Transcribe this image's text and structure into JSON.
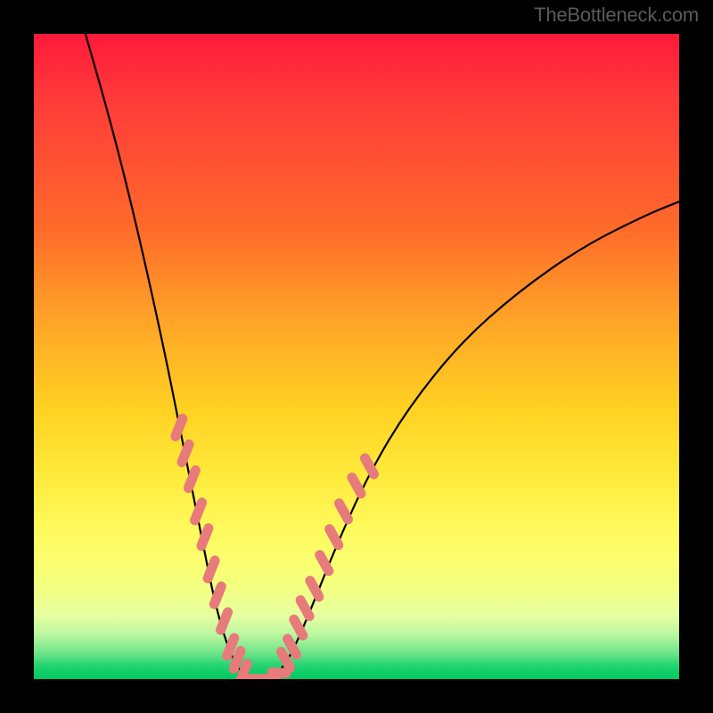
{
  "watermark": {
    "text": "TheBottleneck.com"
  },
  "chart_data": {
    "type": "line",
    "title": "",
    "xlabel": "",
    "ylabel": "",
    "xlim": [
      0,
      100
    ],
    "ylim": [
      0,
      100
    ],
    "curve": {
      "name": "bottleneck-curve",
      "description": "V-shaped bottleneck curve; minimum (green zone) around x≈33, rising steeply on both sides into red zone",
      "points": [
        {
          "x": 8,
          "y": 100
        },
        {
          "x": 12,
          "y": 86
        },
        {
          "x": 16,
          "y": 70
        },
        {
          "x": 20,
          "y": 52
        },
        {
          "x": 23,
          "y": 37
        },
        {
          "x": 26,
          "y": 22
        },
        {
          "x": 28,
          "y": 12
        },
        {
          "x": 30,
          "y": 5
        },
        {
          "x": 32,
          "y": 1
        },
        {
          "x": 34,
          "y": 0
        },
        {
          "x": 36,
          "y": 0
        },
        {
          "x": 38,
          "y": 1
        },
        {
          "x": 40,
          "y": 4
        },
        {
          "x": 43,
          "y": 11
        },
        {
          "x": 47,
          "y": 21
        },
        {
          "x": 52,
          "y": 32
        },
        {
          "x": 58,
          "y": 42
        },
        {
          "x": 66,
          "y": 52
        },
        {
          "x": 75,
          "y": 60
        },
        {
          "x": 85,
          "y": 67
        },
        {
          "x": 95,
          "y": 72
        },
        {
          "x": 100,
          "y": 74
        }
      ]
    },
    "markers": {
      "name": "highlighted-points",
      "color": "#e77a7a",
      "description": "Coral/pink dashed-stroke marker segments near the bottom of the V on both arms",
      "left_arm": [
        {
          "x": 22.5,
          "y": 39
        },
        {
          "x": 23.5,
          "y": 35
        },
        {
          "x": 24.5,
          "y": 31
        },
        {
          "x": 25.5,
          "y": 26
        },
        {
          "x": 26.5,
          "y": 22
        },
        {
          "x": 27.5,
          "y": 17
        },
        {
          "x": 28.5,
          "y": 13
        },
        {
          "x": 29.5,
          "y": 9
        },
        {
          "x": 30.5,
          "y": 5
        },
        {
          "x": 31.5,
          "y": 3
        },
        {
          "x": 32.5,
          "y": 1
        }
      ],
      "bottom": [
        {
          "x": 33.5,
          "y": 0
        },
        {
          "x": 35,
          "y": 0
        },
        {
          "x": 36.5,
          "y": 0
        },
        {
          "x": 38,
          "y": 1
        }
      ],
      "right_arm": [
        {
          "x": 39,
          "y": 3
        },
        {
          "x": 40,
          "y": 5
        },
        {
          "x": 41,
          "y": 8
        },
        {
          "x": 42,
          "y": 11
        },
        {
          "x": 43.5,
          "y": 14
        },
        {
          "x": 45,
          "y": 18
        },
        {
          "x": 46.5,
          "y": 22
        },
        {
          "x": 48,
          "y": 26
        },
        {
          "x": 50,
          "y": 30
        },
        {
          "x": 52,
          "y": 33
        }
      ]
    }
  }
}
